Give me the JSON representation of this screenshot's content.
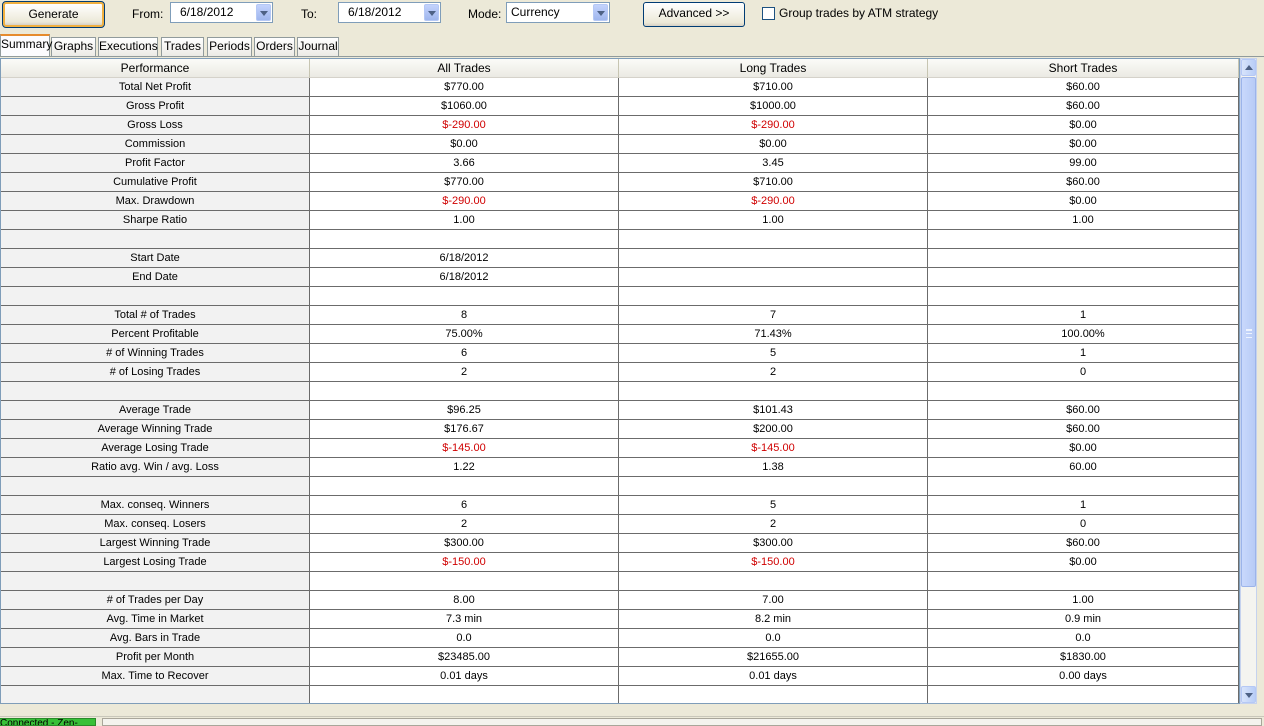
{
  "toolbar": {
    "generate_label": "Generate",
    "from_label": "From:",
    "from_value": "6/18/2012",
    "to_label": "To:",
    "to_value": "6/18/2012",
    "mode_label": "Mode:",
    "mode_value": "Currency",
    "advanced_label": "Advanced >>",
    "group_atm_label": "Group trades by ATM strategy",
    "group_atm_checked": false
  },
  "tabs": [
    "Summary",
    "Graphs",
    "Executions",
    "Trades",
    "Periods",
    "Orders",
    "Journal"
  ],
  "active_tab": "Summary",
  "table": {
    "columns": [
      "Performance",
      "All Trades",
      "Long Trades",
      "Short Trades"
    ],
    "rows": [
      [
        "Total Net Profit",
        "$770.00",
        "$710.00",
        "$60.00"
      ],
      [
        "Gross Profit",
        "$1060.00",
        "$1000.00",
        "$60.00"
      ],
      [
        "Gross Loss",
        "$-290.00",
        "$-290.00",
        "$0.00"
      ],
      [
        "Commission",
        "$0.00",
        "$0.00",
        "$0.00"
      ],
      [
        "Profit Factor",
        "3.66",
        "3.45",
        "99.00"
      ],
      [
        "Cumulative Profit",
        "$770.00",
        "$710.00",
        "$60.00"
      ],
      [
        "Max. Drawdown",
        "$-290.00",
        "$-290.00",
        "$0.00"
      ],
      [
        "Sharpe Ratio",
        "1.00",
        "1.00",
        "1.00"
      ],
      [
        "",
        "",
        "",
        ""
      ],
      [
        "Start Date",
        "6/18/2012",
        "",
        ""
      ],
      [
        "End Date",
        "6/18/2012",
        "",
        ""
      ],
      [
        "",
        "",
        "",
        ""
      ],
      [
        "Total # of Trades",
        "8",
        "7",
        "1"
      ],
      [
        "Percent Profitable",
        "75.00%",
        "71.43%",
        "100.00%"
      ],
      [
        "# of Winning Trades",
        "6",
        "5",
        "1"
      ],
      [
        "# of Losing Trades",
        "2",
        "2",
        "0"
      ],
      [
        "",
        "",
        "",
        ""
      ],
      [
        "Average Trade",
        "$96.25",
        "$101.43",
        "$60.00"
      ],
      [
        "Average Winning Trade",
        "$176.67",
        "$200.00",
        "$60.00"
      ],
      [
        "Average Losing Trade",
        "$-145.00",
        "$-145.00",
        "$0.00"
      ],
      [
        "Ratio avg. Win / avg. Loss",
        "1.22",
        "1.38",
        "60.00"
      ],
      [
        "",
        "",
        "",
        ""
      ],
      [
        "Max. conseq. Winners",
        "6",
        "5",
        "1"
      ],
      [
        "Max. conseq. Losers",
        "2",
        "2",
        "0"
      ],
      [
        "Largest Winning Trade",
        "$300.00",
        "$300.00",
        "$60.00"
      ],
      [
        "Largest Losing Trade",
        "$-150.00",
        "$-150.00",
        "$0.00"
      ],
      [
        "",
        "",
        "",
        ""
      ],
      [
        "# of Trades per Day",
        "8.00",
        "7.00",
        "1.00"
      ],
      [
        "Avg. Time in Market",
        "7.3 min",
        "8.2 min",
        "0.9 min"
      ],
      [
        "Avg. Bars in Trade",
        "0.0",
        "0.0",
        "0.0"
      ],
      [
        "Profit per Month",
        "$23485.00",
        "$21655.00",
        "$1830.00"
      ],
      [
        "Max. Time to Recover",
        "0.01 days",
        "0.01 days",
        "0.00 days"
      ],
      [
        "",
        "",
        "",
        ""
      ]
    ]
  },
  "status": {
    "connection_text": "Connected - Zen-Fire"
  },
  "colors": {
    "negative": "#d00000",
    "tab_highlight": "#e68b2c",
    "connected": "#38c038"
  }
}
